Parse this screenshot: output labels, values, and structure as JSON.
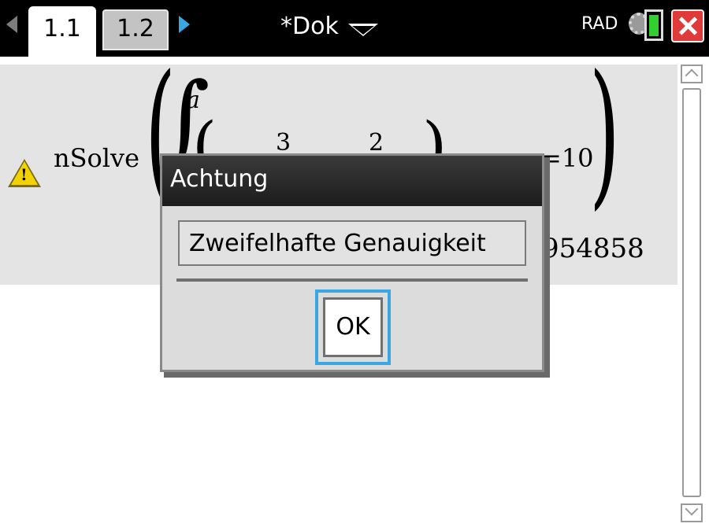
{
  "topbar": {
    "tabs": [
      {
        "label": "1.1",
        "active": true
      },
      {
        "label": "1.2",
        "active": false
      }
    ],
    "document_title": "*Dok",
    "angle_mode": "RAD",
    "accent_color": "#3aa8e0",
    "close_color": "#e03b3b"
  },
  "entry": {
    "function": "nSolve",
    "integral_upper": "a",
    "coeff_1": "3",
    "coeff_2": "2",
    "rhs": "=10",
    "result": "954858",
    "status_icon": "warning-icon"
  },
  "dialog": {
    "title": "Achtung",
    "message": "Zweifelhafte Genauigkeit",
    "ok_label": "OK"
  }
}
